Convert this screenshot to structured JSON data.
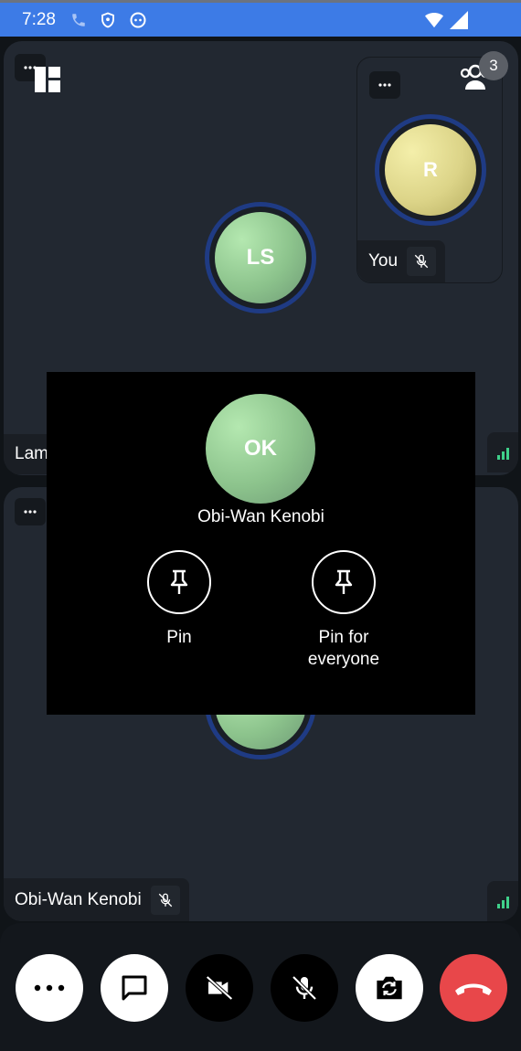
{
  "status_bar": {
    "time": "7:28"
  },
  "participants_badge": {
    "count": "3"
  },
  "tiles": {
    "top": {
      "initials": "LS",
      "name_partial": "Lam"
    },
    "self": {
      "initials": "R",
      "name": "You"
    },
    "bottom": {
      "name": "Obi-Wan Kenobi"
    }
  },
  "overlay": {
    "initials": "OK",
    "name": "Obi-Wan Kenobi",
    "pin_label": "Pin",
    "pin_everyone_label": "Pin for\neveryone"
  },
  "colors": {
    "status_bar": "#3d7be6",
    "tile_bg": "#222831",
    "ring": "#1f3b84",
    "signal": "#3fd08a",
    "hangup": "#e8474a"
  },
  "controls": [
    "more-icon",
    "chat-icon",
    "video-off-icon",
    "mic-off-icon",
    "switch-camera-icon",
    "hang-up-icon"
  ]
}
